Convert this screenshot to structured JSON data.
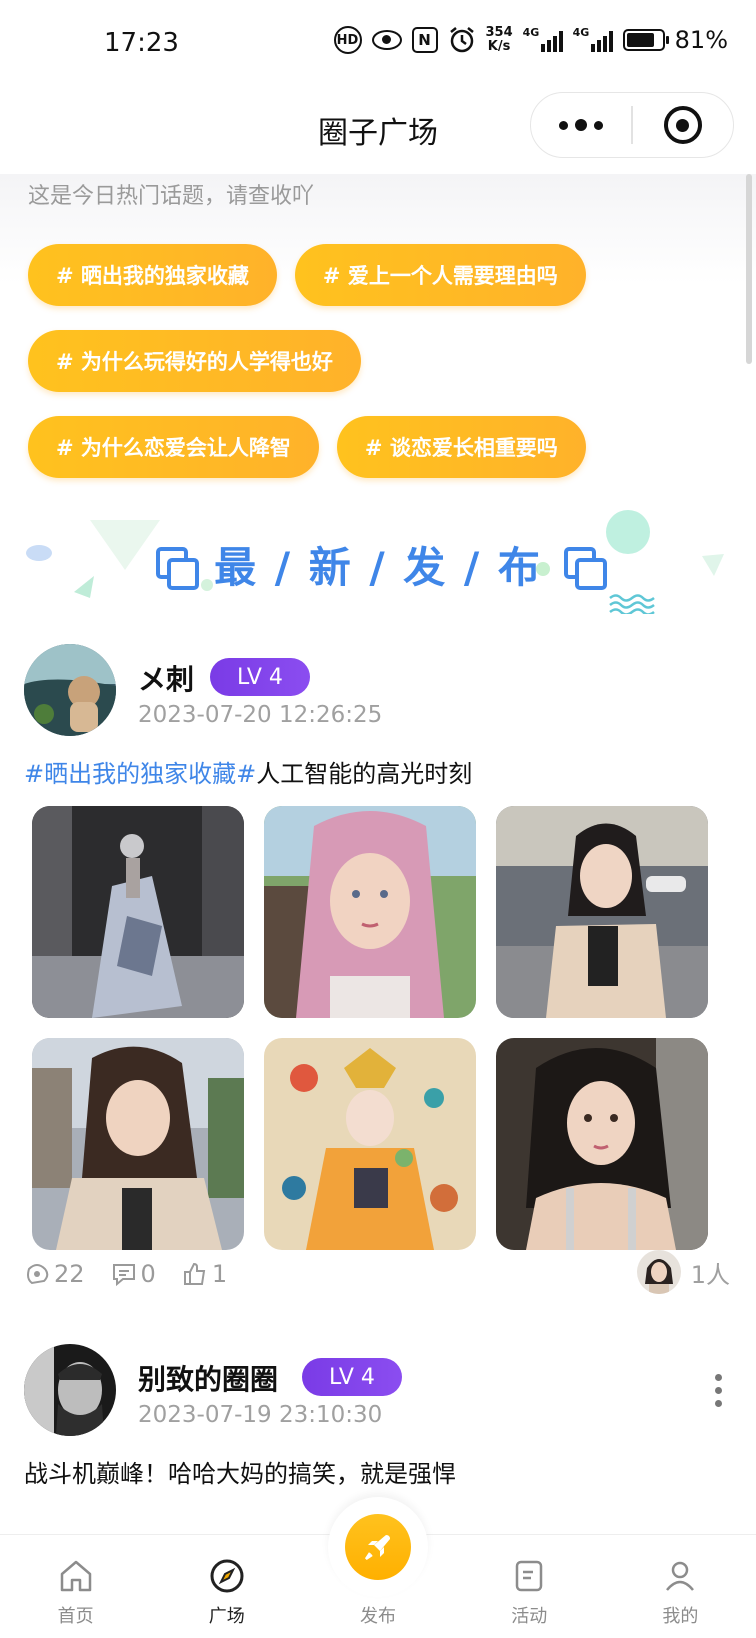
{
  "status_bar": {
    "time": "17:23",
    "net_speed_value": "354",
    "net_speed_unit": "K/s",
    "signal1_label": "4G",
    "signal2_label": "4G",
    "battery_pct": "81%",
    "battery_level": 0.81
  },
  "header": {
    "title": "圈子广场"
  },
  "topics": {
    "hint": "这是今日热门话题，请查收吖",
    "rows": [
      [
        "# 晒出我的独家收藏",
        "# 爱上一个人需要理由吗"
      ],
      [
        "# 为什么玩得好的人学得也好"
      ],
      [
        "# 为什么恋爱会让人降智",
        "# 谈恋爱长相重要吗"
      ]
    ]
  },
  "latest": {
    "title": "最 / 新 / 发 / 布"
  },
  "posts": [
    {
      "user": "メ刺",
      "level": "LV 4",
      "time": "2023-07-20 12:26:25",
      "tag": "#晒出我的独家收藏#",
      "text": "人工智能的高光时刻",
      "views": "22",
      "comments": "0",
      "likes": "1",
      "liked_count": "1人"
    },
    {
      "user": "别致的圈圈",
      "level": "LV 4",
      "time": "2023-07-19 23:10:30",
      "text": "战斗机巅峰！哈哈大妈的搞笑，就是强悍"
    }
  ],
  "tabs": [
    {
      "label": "首页",
      "icon": "home-icon"
    },
    {
      "label": "广场",
      "icon": "compass-icon"
    },
    {
      "label": "发布",
      "icon": "rocket-icon"
    },
    {
      "label": "活动",
      "icon": "document-icon"
    },
    {
      "label": "我的",
      "icon": "user-icon"
    }
  ],
  "colors": {
    "accent_yellow": "#ffb81f",
    "link_blue": "#3f86e8",
    "level_purple": "#7a3be6"
  }
}
